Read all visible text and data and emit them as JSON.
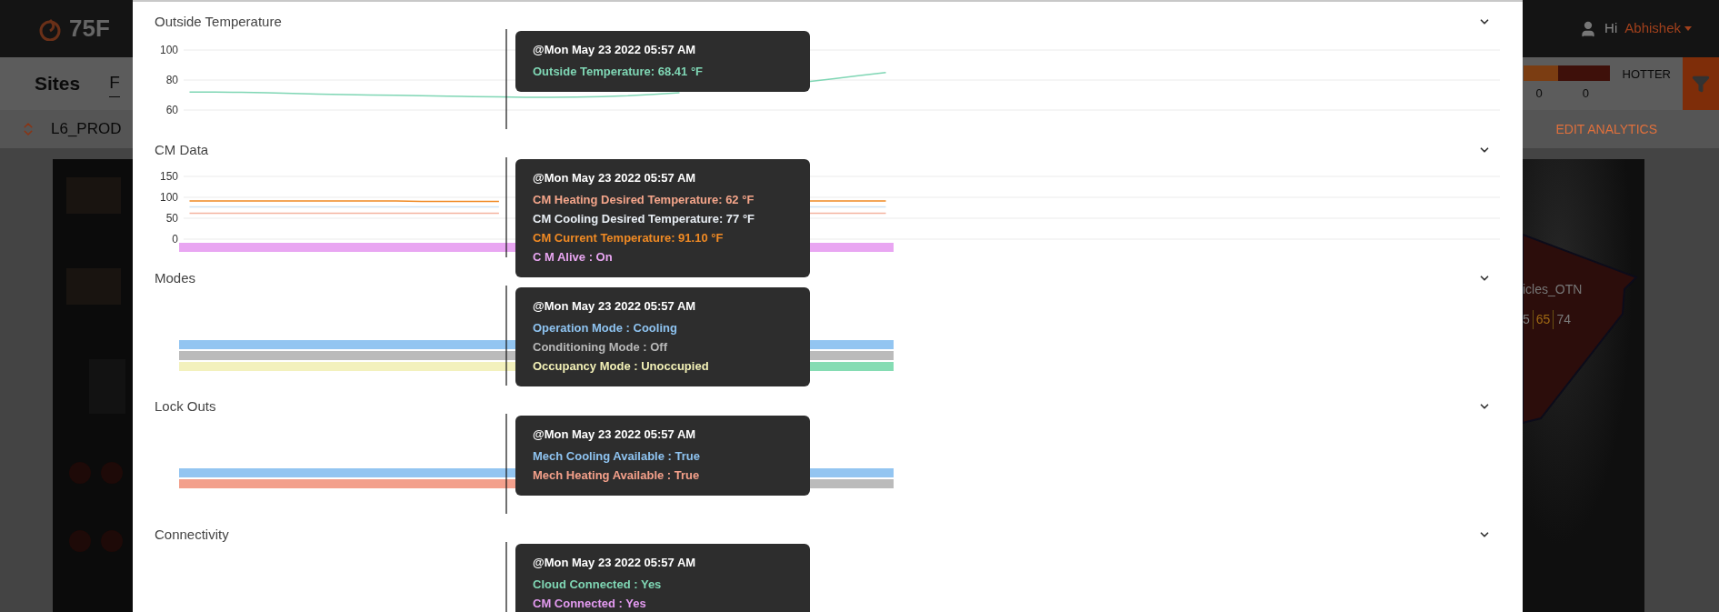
{
  "app": {
    "logo": "75F",
    "greeting": "Hi",
    "user": "Abhishek",
    "page_title": "Sites",
    "tab_partial": "F",
    "site": "L6_PROD",
    "action": "EDIT ANALYTICS",
    "legend": {
      "label": "HOTTER",
      "counts": [
        "0",
        "0"
      ]
    },
    "zone": {
      "name": "icles_OTN",
      "readings": [
        {
          "text": "5",
          "color": "#7a7a7a"
        },
        {
          "text": "65",
          "color": "#a06a14"
        },
        {
          "text": "74",
          "color": "#7a7a7a"
        }
      ]
    }
  },
  "sections": [
    {
      "title": "Outside Temperature",
      "kind": "line",
      "chart_data": {
        "type": "line",
        "grid": true,
        "ylim": [
          60,
          100
        ],
        "yticks": [
          60,
          80,
          100
        ],
        "series": [
          {
            "color": "#7fd6b4",
            "values": [
              72,
              72,
              71.8,
              71.5,
              71,
              70.6,
              70.3,
              70,
              69.8,
              69.5,
              69.3,
              69,
              68.8,
              68.5,
              68.4,
              68.6,
              69,
              69.5,
              70.5,
              71.5,
              null,
              null,
              null,
              null,
              79,
              81,
              83,
              85,
              null,
              null,
              null,
              null,
              null,
              null,
              null,
              null,
              null,
              null,
              null,
              null,
              null,
              null,
              null,
              null,
              null,
              null,
              null,
              null,
              null,
              null,
              null
            ]
          }
        ]
      },
      "tooltip": {
        "timestamp": "@Mon May 23 2022 05:57 AM",
        "entries": [
          {
            "text": "Outside Temperature: 68.41 °F",
            "color": "#7fd6b4"
          }
        ]
      }
    },
    {
      "title": "CM Data",
      "kind": "line",
      "chart_data": {
        "type": "line",
        "grid": true,
        "ylim": [
          0,
          150
        ],
        "yticks": [
          0,
          50,
          100,
          150
        ],
        "series": [
          {
            "color": "#f4b3a0",
            "values": [
              62,
              62,
              62,
              62,
              62,
              62,
              62,
              62,
              62,
              62,
              62,
              62,
              62,
              null,
              null,
              null,
              null,
              null,
              null,
              null,
              null,
              null,
              null,
              null,
              62,
              62,
              62,
              62,
              null,
              null,
              null,
              null,
              null,
              null,
              null,
              null,
              null,
              null,
              null,
              null,
              null,
              null,
              null,
              null,
              null,
              null,
              null,
              null,
              null,
              null,
              null
            ]
          },
          {
            "color": "#cfe3f3",
            "values": [
              77,
              77,
              77,
              77,
              77,
              77,
              77,
              77,
              77,
              77,
              77,
              77,
              77,
              null,
              null,
              null,
              null,
              null,
              null,
              null,
              null,
              null,
              null,
              null,
              77,
              77,
              77,
              77,
              null,
              null,
              null,
              null,
              null,
              null,
              null,
              null,
              null,
              null,
              null,
              null,
              null,
              null,
              null,
              null,
              null,
              null,
              null,
              null,
              null,
              null,
              null
            ]
          },
          {
            "color": "#f08a24",
            "values": [
              91,
              91,
              91,
              91,
              91,
              91,
              91,
              91,
              91,
              90,
              90,
              90,
              90,
              null,
              null,
              null,
              null,
              null,
              null,
              null,
              null,
              null,
              null,
              null,
              91,
              91,
              91,
              91,
              null,
              null,
              null,
              null,
              null,
              null,
              null,
              null,
              null,
              null,
              null,
              null,
              null,
              null,
              null,
              null,
              null,
              null,
              null,
              null,
              null,
              null,
              null
            ]
          }
        ]
      },
      "bands": [
        {
          "segments": [
            {
              "color": "#e9a6f2"
            }
          ]
        }
      ],
      "tooltip": {
        "timestamp": "@Mon May 23 2022 05:57 AM",
        "entries": [
          {
            "text": "CM Heating Desired Temperature: 62 °F",
            "color": "#f4a58a"
          },
          {
            "text": "CM Cooling Desired Temperature: 77 °F",
            "color": "#e8eef4"
          },
          {
            "text": "CM Current Temperature: 91.10 °F",
            "color": "#f08a24"
          },
          {
            "text": "C M Alive : On",
            "color": "#e9a6f2"
          }
        ]
      }
    },
    {
      "title": "Modes",
      "kind": "timeline",
      "bands": [
        {
          "segments": [
            {
              "color": "#93c5f1"
            }
          ]
        },
        {
          "segments": [
            {
              "color": "#bbbbbb"
            }
          ]
        },
        {
          "segments": [
            {
              "color": "#f3f1bd"
            },
            {
              "color": "#85dcb3"
            }
          ]
        }
      ],
      "tooltip": {
        "timestamp": "@Mon May 23 2022 05:57 AM",
        "entries": [
          {
            "text": "Operation Mode : Cooling",
            "color": "#8ec3f0"
          },
          {
            "text": "Conditioning Mode : Off",
            "color": "#b8b8b8"
          },
          {
            "text": "Occupancy Mode : Unoccupied",
            "color": "#f2f0b6"
          }
        ]
      }
    },
    {
      "title": "Lock Outs",
      "kind": "timeline",
      "bands": [
        {
          "segments": [
            {
              "color": "#93c5f1"
            }
          ]
        },
        {
          "segments": [
            {
              "color": "#f3a08c"
            },
            {
              "color": "#bbbbbb"
            }
          ]
        }
      ],
      "tooltip": {
        "timestamp": "@Mon May 23 2022 05:57 AM",
        "entries": [
          {
            "text": "Mech Cooling Available : True",
            "color": "#8ec3f0"
          },
          {
            "text": "Mech Heating Available : True",
            "color": "#f4a08a"
          }
        ]
      }
    },
    {
      "title": "Connectivity",
      "kind": "timeline",
      "tooltip": {
        "timestamp": "@Mon May 23 2022 05:57 AM",
        "entries": [
          {
            "text": "Cloud Connected : Yes",
            "color": "#7fd6b4"
          },
          {
            "text": "CM Connected : Yes",
            "color": "#e39af0"
          }
        ]
      }
    }
  ]
}
